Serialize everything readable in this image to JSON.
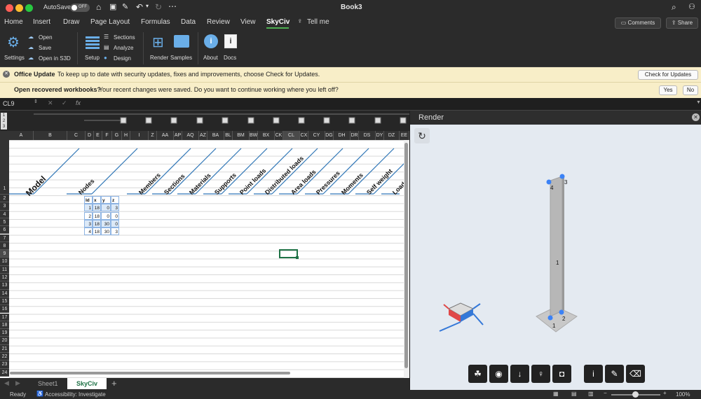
{
  "titlebar": {
    "autosave_label": "AutoSave",
    "autosave_state": "OFF",
    "doc_title": "Book3"
  },
  "tabs": [
    "Home",
    "Insert",
    "Draw",
    "Page Layout",
    "Formulas",
    "Data",
    "Review",
    "View",
    "SkyCiv",
    "Tell me"
  ],
  "active_tab": "SkyCiv",
  "header_buttons": {
    "comments": "Comments",
    "share": "Share"
  },
  "ribbon": {
    "settings": "Settings",
    "open": "Open",
    "save": "Save",
    "open_s3d": "Open in S3D",
    "setup": "Setup",
    "sections": "Sections",
    "analyze": "Analyze",
    "design": "Design",
    "render": "Render",
    "samples": "Samples",
    "about": "About",
    "docs": "Docs"
  },
  "update_banner": {
    "title": "Office Update",
    "message": "To keep up to date with security updates, fixes and improvements, choose Check for Updates.",
    "button": "Check for Updates"
  },
  "recover_banner": {
    "title": "Open recovered workbooks?",
    "message": "Your recent changes were saved. Do you want to continue working where you left off?",
    "yes": "Yes",
    "no": "No"
  },
  "formula_bar": {
    "cell_ref": "CL9",
    "fx": "fx"
  },
  "outline_levels": [
    "1",
    "2",
    "3"
  ],
  "columns": [
    "A",
    "B",
    "C",
    "D",
    "E",
    "F",
    "G",
    "H",
    "I",
    "Z",
    "AA",
    "AP",
    "AQ",
    "AZ",
    "BA",
    "BL",
    "BM",
    "BW",
    "BX",
    "CK",
    "CL",
    "CX",
    "CY",
    "DG",
    "DH",
    "DR",
    "DS",
    "DY",
    "DZ",
    "EE"
  ],
  "rows": [
    "1",
    "2",
    "3",
    "4",
    "5",
    "6",
    "7",
    "8",
    "9",
    "10",
    "11",
    "12",
    "13",
    "14",
    "15",
    "16",
    "17",
    "18",
    "19",
    "20",
    "21",
    "22",
    "23",
    "24"
  ],
  "section_headers": [
    "Model",
    "Nodes",
    "Members",
    "Sections",
    "Materials",
    "Supports",
    "Point loads",
    "Distributed loads",
    "Area loads",
    "Pressures",
    "Moments",
    "Self weight",
    "Load c"
  ],
  "nodes_table": {
    "headers": [
      "Id",
      "x",
      "y",
      "z"
    ],
    "rows": [
      [
        "1",
        "18",
        "0",
        "3"
      ],
      [
        "2",
        "18",
        "0",
        "0"
      ],
      [
        "3",
        "18",
        "30",
        "0"
      ],
      [
        "4",
        "18",
        "30",
        "3"
      ]
    ]
  },
  "sheet_tabs": [
    "Sheet1",
    "SkyCiv"
  ],
  "active_sheet": "SkyCiv",
  "render_panel": {
    "title": "Render",
    "node_labels": [
      "1",
      "2",
      "3",
      "4"
    ],
    "member_label": "1"
  },
  "status": {
    "ready": "Ready",
    "accessibility": "Accessibility: Investigate",
    "zoom": "100%"
  },
  "colors": {
    "accent_green": "#2e7d32",
    "banner_bg": "#f8eec8",
    "node_blue": "#3b82f6"
  }
}
